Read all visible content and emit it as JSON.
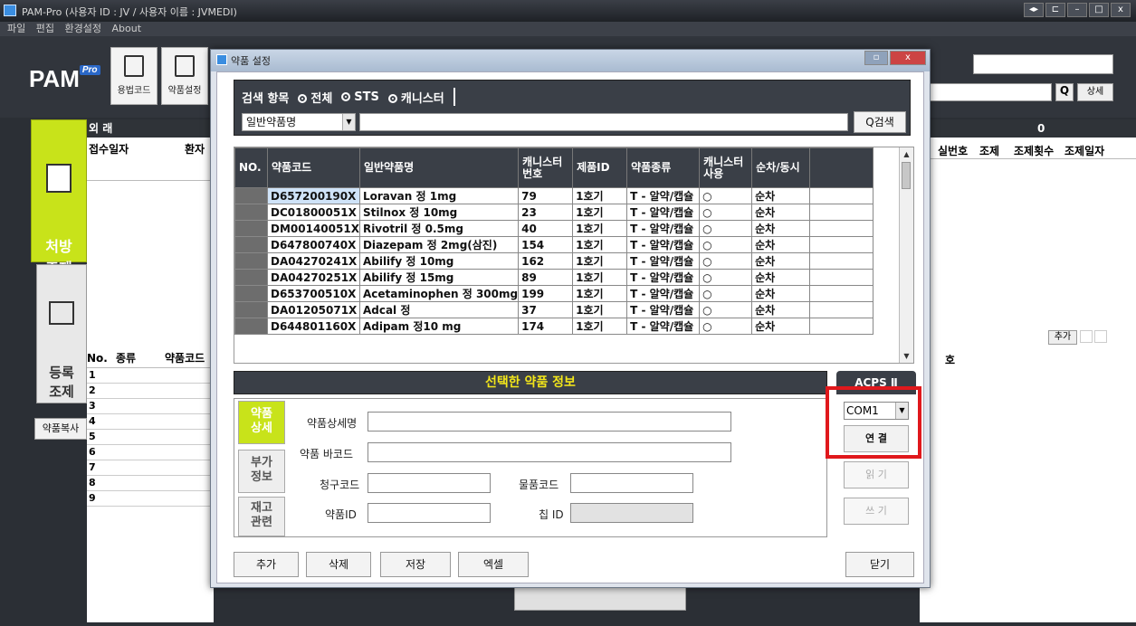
{
  "app": {
    "title": "PAM-Pro (사용자 ID : JV / 사용자 이름 : JVMEDI)",
    "menu": [
      "파일",
      "편집",
      "환경설정",
      "About"
    ],
    "logo": "PAM",
    "logo_badge": "Pro",
    "toolbar": {
      "yongbeob_label": "용법코드",
      "drug_setting_label": "약품설정"
    },
    "side_tabs": {
      "prescription": "처방\n조제",
      "register": "등록\n조제",
      "drug_copy": "약품복사"
    },
    "left_table": {
      "section_title": "외 래",
      "col_date": "접수일자",
      "col_patient": "환자"
    },
    "right_table": {
      "count": "0",
      "col_room": "실번호",
      "col_dispense": "조제",
      "col_times": "조제횟수",
      "col_date": "조제일자",
      "detail_btn": "상세",
      "search_icon": "search-icon"
    },
    "lower_left": {
      "col_no": "No.",
      "col_type": "종류",
      "col_code": "약품코드",
      "rows": [
        "1",
        "2",
        "3",
        "4",
        "5",
        "6",
        "7",
        "8",
        "9"
      ]
    },
    "lower_right": {
      "col_no": "호",
      "add_btn": "추가"
    }
  },
  "dialog": {
    "title": "약품 설정",
    "search": {
      "label": "검색 항목",
      "options": [
        "전체",
        "STS",
        "캐니스터"
      ],
      "selected": "전체",
      "category": "일반약품명",
      "keyword": "",
      "search_btn": "검색"
    },
    "grid": {
      "headers": [
        "NO.",
        "약품코드",
        "일반약품명",
        "캐니스터\n번호",
        "제품ID",
        "약품종류",
        "캐니스터\n사용",
        "순차/동시"
      ],
      "rows": [
        [
          "D657200190X",
          "Loravan 정 1mg",
          "79",
          "1호기",
          "T - 알약/캡슐",
          "○",
          "순차"
        ],
        [
          "DC01800051X",
          "Stilnox 정 10mg",
          "23",
          "1호기",
          "T - 알약/캡슐",
          "○",
          "순차"
        ],
        [
          "DM00140051X",
          "Rivotril 정 0.5mg",
          "40",
          "1호기",
          "T - 알약/캡슐",
          "○",
          "순차"
        ],
        [
          "D647800740X",
          "Diazepam 정 2mg(삼진)",
          "154",
          "1호기",
          "T - 알약/캡슐",
          "○",
          "순차"
        ],
        [
          "DA04270241X",
          "Abilify 정 10mg",
          "162",
          "1호기",
          "T - 알약/캡슐",
          "○",
          "순차"
        ],
        [
          "DA04270251X",
          "Abilify 정 15mg",
          "89",
          "1호기",
          "T - 알약/캡슐",
          "○",
          "순차"
        ],
        [
          "D653700510X",
          "Acetaminophen 정 300mg",
          "199",
          "1호기",
          "T - 알약/캡슐",
          "○",
          "순차"
        ],
        [
          "DA01205071X",
          "Adcal 정",
          "37",
          "1호기",
          "T - 알약/캡슐",
          "○",
          "순차"
        ],
        [
          "D644801160X",
          "Adipam 정10 mg",
          "174",
          "1호기",
          "T - 알약/캡슐",
          "○",
          "순차"
        ]
      ]
    },
    "selected_header": "선택한 약품 정보",
    "detail_tabs": [
      "약품\n상세",
      "부가\n정보",
      "재고\n관련"
    ],
    "detail": {
      "name_label": "약품상세명",
      "name_value": "",
      "barcode_label": "약품 바코드",
      "barcode_value": "",
      "claim_label": "청구코드",
      "claim_value": "",
      "goods_label": "물품코드",
      "goods_value": "",
      "drugid_label": "약품ID",
      "drugid_value": "",
      "chip_label": "칩 ID",
      "chip_value": ""
    },
    "acps": {
      "caption": "ACPS Ⅱ",
      "port": "COM1",
      "connect": "연 결",
      "read": "읽 기",
      "write": "쓰 기"
    },
    "buttons": {
      "add": "추가",
      "delete": "삭제",
      "save": "저장",
      "excel": "엑셀",
      "close": "닫기"
    },
    "titlebar_btns": {
      "restore": "▫",
      "close": "x"
    }
  },
  "colors": {
    "accent_green": "#c8e31a",
    "dark_header": "#3a3f47",
    "highlight_red": "#e0181c",
    "selected_yellow": "#f3e61a"
  }
}
